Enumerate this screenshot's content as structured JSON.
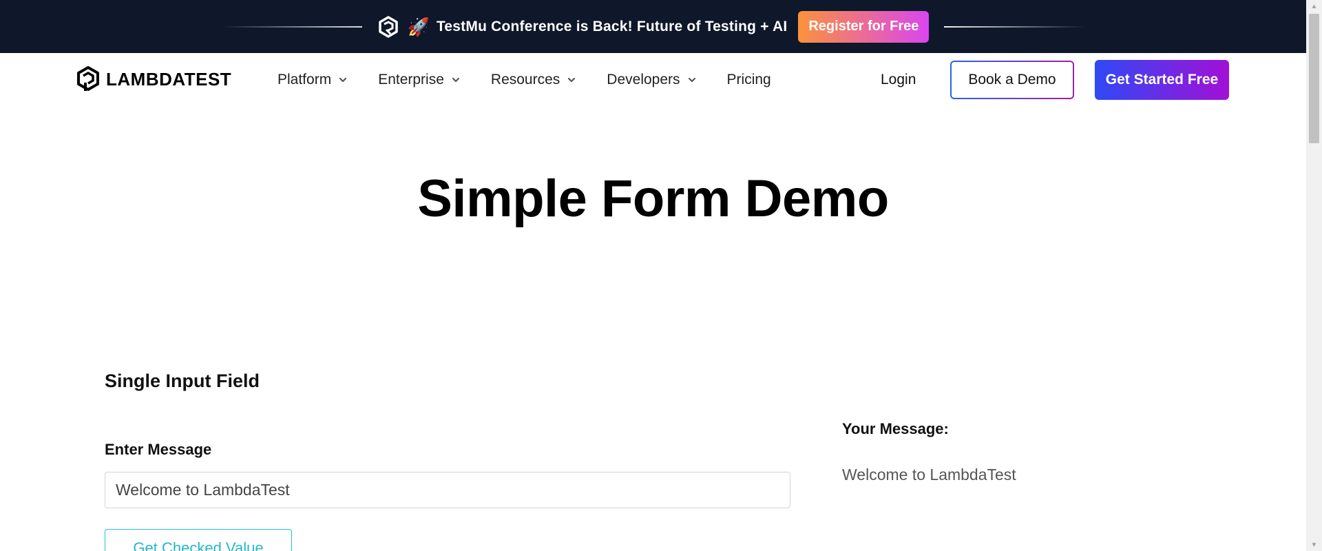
{
  "banner": {
    "rocket_emoji": "🚀",
    "text": "TestMu Conference is Back! Future of Testing + AI",
    "register_label": "Register for Free",
    "background": "#0f172a"
  },
  "nav": {
    "logo_text": "LAMBDATEST",
    "items": [
      {
        "label": "Platform",
        "has_dropdown": true
      },
      {
        "label": "Enterprise",
        "has_dropdown": true
      },
      {
        "label": "Resources",
        "has_dropdown": true
      },
      {
        "label": "Developers",
        "has_dropdown": true
      },
      {
        "label": "Pricing",
        "has_dropdown": false
      }
    ],
    "login_label": "Login",
    "book_demo_label": "Book a Demo",
    "get_started_label": "Get Started Free"
  },
  "main": {
    "title": "Simple Form Demo",
    "section_title": "Single Input Field",
    "enter_message_label": "Enter Message",
    "message_value": "Welcome to LambdaTest",
    "checked_button_label": "Get Checked Value",
    "your_message_label": "Your Message:",
    "your_message_value": "Welcome to LambdaTest"
  },
  "colors": {
    "accent_teal": "#22c1cc",
    "cta_gradient_start": "#2f49f5",
    "cta_gradient_end": "#a210d6"
  },
  "icons": {
    "banner_logo": "testmu-logo-icon",
    "brand_logo": "lambdatest-logo-icon",
    "dropdown": "chevron-down-icon"
  }
}
